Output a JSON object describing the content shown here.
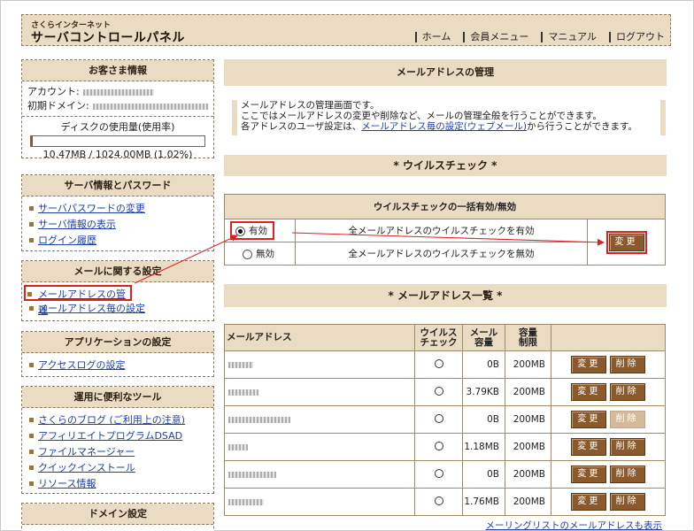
{
  "header": {
    "brand_small": "さくらインターネット",
    "brand_title": "サーバコントロールパネル",
    "nav": [
      "ホーム",
      "会員メニュー",
      "マニュアル",
      "ログアウト"
    ]
  },
  "customer": {
    "title": "お客さま情報",
    "account_label": "アカウント:",
    "domain_label": "初期ドメイン:",
    "disk_label": "ディスクの使用量(使用率)",
    "disk_value": "10.47MB / 1024.00MB (1.02%)",
    "disk_usage_percent": 1.02
  },
  "server": {
    "title": "サーバ情報とパスワード",
    "items": [
      "サーバパスワードの変更",
      "サーバ情報の表示",
      "ログイン履歴"
    ]
  },
  "mail": {
    "title": "メールに関する設定",
    "items": [
      "メールアドレスの管理",
      "メールアドレス毎の設定"
    ]
  },
  "app": {
    "title": "アプリケーションの設定",
    "items": [
      "アクセスログの設定"
    ]
  },
  "tools": {
    "title": "運用に便利なツール",
    "items": [
      "さくらのブログ (ご利用上の注意)",
      "アフィリエイトプログラムDSAD",
      "ファイルマネージャー",
      "クイックインストール",
      "リソース情報"
    ]
  },
  "domain": {
    "title": "ドメイン設定"
  },
  "main": {
    "title": "メールアドレスの管理",
    "desc1": "メールアドレスの管理画面です。",
    "desc2": "ここではメールアドレスの変更や削除など、メールの管理全般を行うことができます。",
    "desc3_pre": "各アドレスのユーザ設定は、",
    "desc3_link": "メールアドレス毎の設定(ウェブメール)",
    "desc3_post": "から行うことができます。",
    "virus_section": "* ウイルスチェック *",
    "virus_table_title": "ウイルスチェックの一括有効/無効",
    "opt_on": "有効",
    "opt_on_desc": "全メールアドレスのウイルスチェックを有効",
    "opt_off": "無効",
    "opt_off_desc": "全メールアドレスのウイルスチェックを無効",
    "change_btn": "変更",
    "list_section": "* メールアドレス一覧 *",
    "columns": {
      "address": "メールアドレス",
      "virus1": "ウイルス",
      "virus2": "チェック",
      "mail1": "メール",
      "mail2": "容量",
      "cap1": "容量",
      "cap2": "制限"
    },
    "rows": [
      {
        "usage": "0B",
        "limit": "200MB",
        "del_enabled": true
      },
      {
        "usage": "3.79KB",
        "limit": "200MB",
        "del_enabled": true
      },
      {
        "usage": "0B",
        "limit": "200MB",
        "del_enabled": false
      },
      {
        "usage": "1.18MB",
        "limit": "200MB",
        "del_enabled": true
      },
      {
        "usage": "0B",
        "limit": "200MB",
        "del_enabled": true
      },
      {
        "usage": "1.76MB",
        "limit": "200MB",
        "del_enabled": true
      }
    ],
    "edit_btn": "変更",
    "delete_btn": "削除",
    "ml_link": "メーリングリストのメールアドレスも表示"
  }
}
